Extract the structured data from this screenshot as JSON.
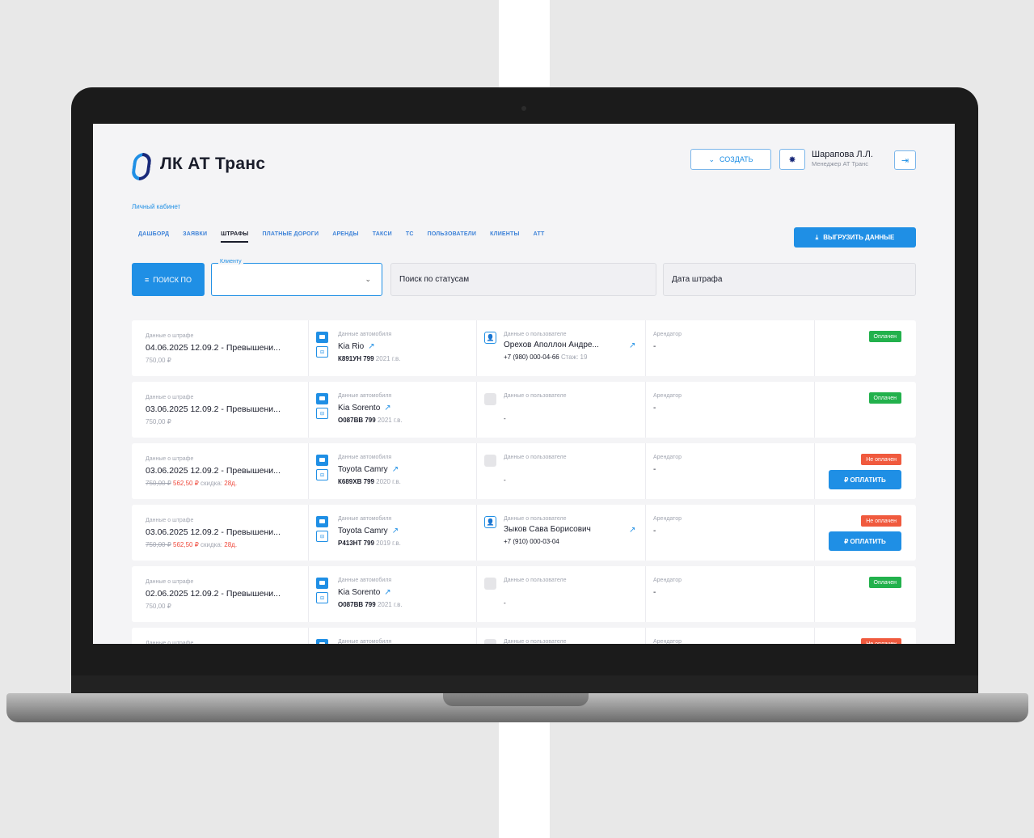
{
  "app": {
    "logo_text": "ЛК АТ Транс"
  },
  "header": {
    "create_label": "СОЗДАТЬ",
    "user_name": "Шарапова Л.Л.",
    "user_role": "Менеджер АТ Транс"
  },
  "breadcrumb": "Личный кабинет",
  "tabs": [
    "ДАШБОРД",
    "ЗАЯВКИ",
    "ШТРАФЫ",
    "ПЛАТНЫЕ ДОРОГИ",
    "АРЕНДЫ",
    "ТАКСИ",
    "ТС",
    "ПОЛЬЗОВАТЕЛИ",
    "КЛИЕНТЫ",
    "АТТ"
  ],
  "active_tab": "ШТРАФЫ",
  "export_label": "ВЫГРУЗИТЬ ДАННЫЕ",
  "filters": {
    "search_label": "ПОИСК ПО",
    "client_label": "Клиенту",
    "status_placeholder": "Поиск по статусам",
    "date_placeholder": "Дата штрафа"
  },
  "labels": {
    "fine": "Данные о штрафе",
    "car": "Данные автомобиля",
    "user": "Данные о пользователе",
    "renter": "Арендатор",
    "pay": "₽ ОПЛАТИТЬ"
  },
  "rows": [
    {
      "fine_title": "04.06.2025 12.09.2 - Превышени...",
      "amount": "750,00 ₽",
      "old_amount": "",
      "new_amount": "",
      "discount": "",
      "car": "Kia Rio",
      "plate": "К891УН 799",
      "year": "2021 г.в.",
      "user_name": "Орехов Аполлон Андре...",
      "user_phone": "+7 (980) 000-04-66",
      "user_extra": "Стаж: 19",
      "renter": "-",
      "status": "Оплачен",
      "status_type": "paid"
    },
    {
      "fine_title": "03.06.2025 12.09.2 - Превышени...",
      "amount": "750,00 ₽",
      "old_amount": "",
      "new_amount": "",
      "discount": "",
      "car": "Kia Sorento",
      "plate": "О087ВВ 799",
      "year": "2021 г.в.",
      "user_name": "",
      "user_phone": "-",
      "user_extra": "",
      "renter": "-",
      "status": "Оплачен",
      "status_type": "paid"
    },
    {
      "fine_title": "03.06.2025 12.09.2 - Превышени...",
      "amount": "",
      "old_amount": "750,00 ₽",
      "new_amount": "562,50 ₽",
      "discount": "28д.",
      "car": "Toyota Camry",
      "plate": "К689ХВ 799",
      "year": "2020 г.в.",
      "user_name": "",
      "user_phone": "-",
      "user_extra": "",
      "renter": "-",
      "status": "Не оплачен",
      "status_type": "unpaid"
    },
    {
      "fine_title": "03.06.2025 12.09.2 - Превышени...",
      "amount": "",
      "old_amount": "750,00 ₽",
      "new_amount": "562,50 ₽",
      "discount": "28д.",
      "car": "Toyota Camry",
      "plate": "Р413НТ 799",
      "year": "2019 г.в.",
      "user_name": "Зыков Сава Борисович",
      "user_phone": "+7 (910) 000-03-04",
      "user_extra": "",
      "renter": "-",
      "status": "Не оплачен",
      "status_type": "unpaid"
    },
    {
      "fine_title": "02.06.2025 12.09.2 - Превышени...",
      "amount": "750,00 ₽",
      "old_amount": "",
      "new_amount": "",
      "discount": "",
      "car": "Kia Sorento",
      "plate": "О087ВВ 799",
      "year": "2021 г.в.",
      "user_name": "",
      "user_phone": "-",
      "user_extra": "",
      "renter": "-",
      "status": "Оплачен",
      "status_type": "paid"
    },
    {
      "fine_title": "",
      "amount": "",
      "old_amount": "",
      "new_amount": "",
      "discount": "",
      "car": "",
      "plate": "",
      "year": "",
      "user_name": "",
      "user_phone": "",
      "user_extra": "",
      "renter": "",
      "status": "Не оплачен",
      "status_type": "unpaid"
    }
  ],
  "colors": {
    "accent": "#1f8fe5",
    "paid": "#22b14c",
    "unpaid": "#f05a3e",
    "brand_dark": "#1a2a7a"
  }
}
